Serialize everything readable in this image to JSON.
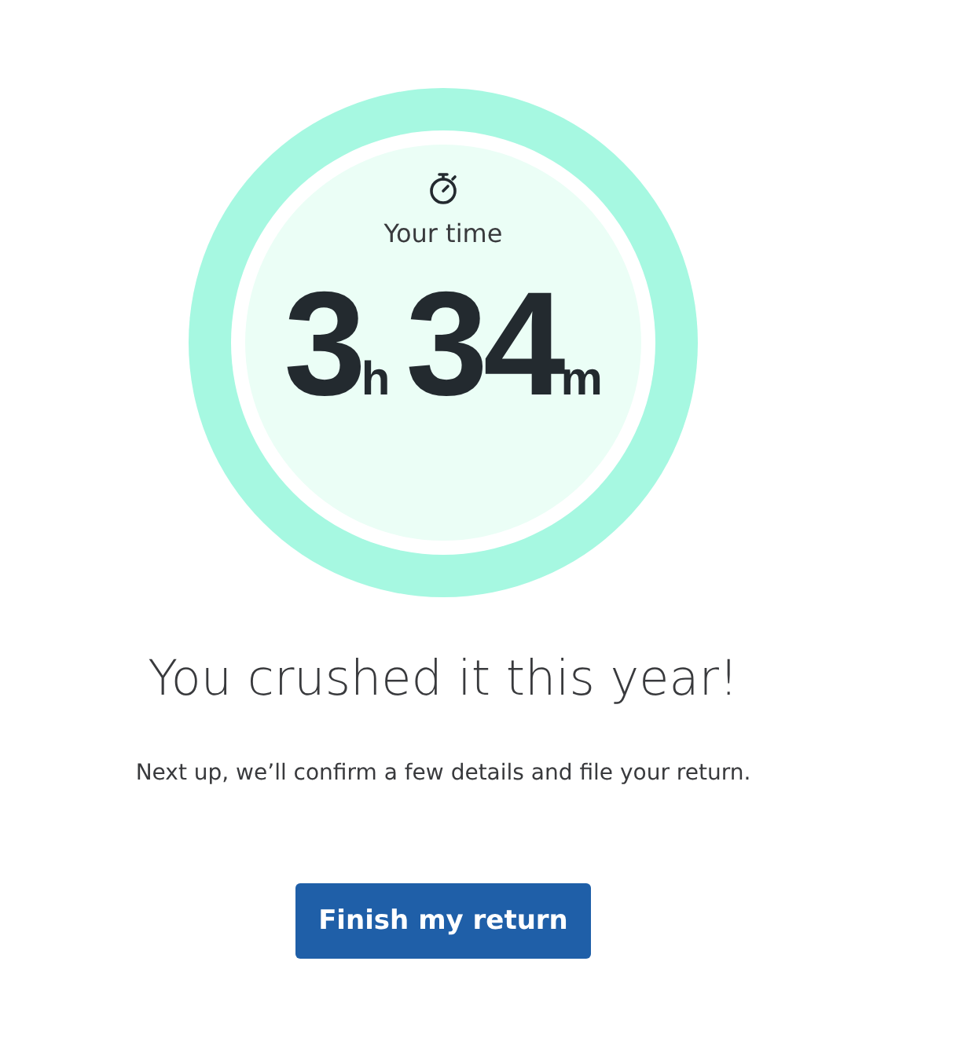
{
  "timer": {
    "label": "Your time",
    "hours": "3",
    "hours_unit": "h",
    "minutes": "34",
    "minutes_unit": "m"
  },
  "headline": "You crushed it this year!",
  "message": "Next up, we’ll confirm a few details and file your return.",
  "button": {
    "label": "Finish my return"
  }
}
